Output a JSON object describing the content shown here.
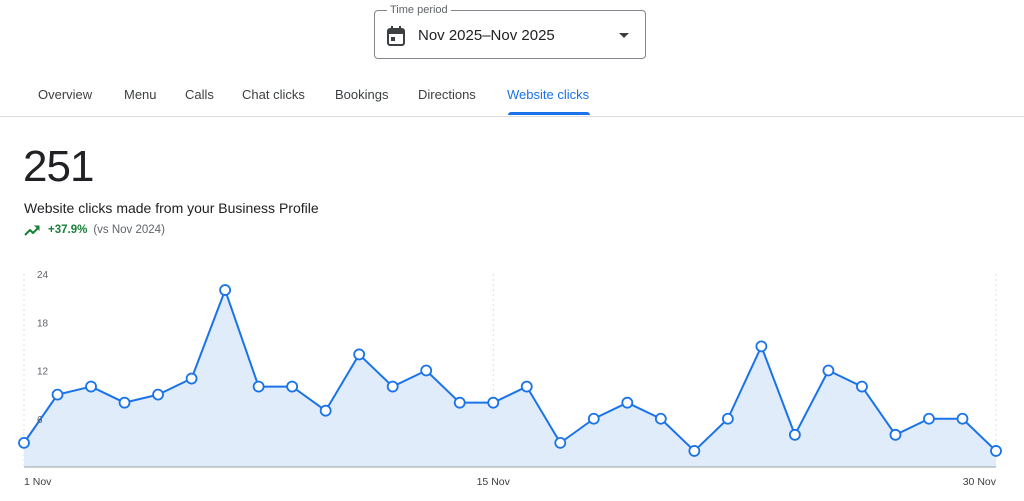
{
  "time_period": {
    "label": "Time period",
    "value": "Nov 2025–Nov 2025",
    "icon": "calendar-icon",
    "caret_icon": "arrow-drop-down-icon"
  },
  "tabs": [
    {
      "label": "Overview",
      "active": false
    },
    {
      "label": "Menu",
      "active": false
    },
    {
      "label": "Calls",
      "active": false
    },
    {
      "label": "Chat clicks",
      "active": false
    },
    {
      "label": "Bookings",
      "active": false
    },
    {
      "label": "Directions",
      "active": false
    },
    {
      "label": "Website clicks",
      "active": true
    }
  ],
  "metric": {
    "total": "251",
    "description": "Website clicks made from your Business Profile",
    "change": "+37.9%",
    "comparison": "(vs Nov 2024)",
    "trend_icon": "trending-up-icon"
  },
  "colors": {
    "accent": "#1a73e8",
    "area_fill": "#e1ecfb",
    "positive": "#188038"
  },
  "chart_data": {
    "type": "area",
    "x": [
      1,
      2,
      3,
      4,
      5,
      6,
      7,
      8,
      9,
      10,
      11,
      12,
      13,
      14,
      15,
      16,
      17,
      18,
      19,
      20,
      21,
      22,
      23,
      24,
      25,
      26,
      27,
      28,
      29,
      30
    ],
    "values": [
      3,
      9,
      10,
      8,
      9,
      11,
      22,
      10,
      10,
      7,
      14,
      10,
      12,
      8,
      8,
      10,
      3,
      6,
      8,
      6,
      2,
      6,
      15,
      4,
      12,
      10,
      4,
      6,
      6,
      2
    ],
    "x_tick_labels": [
      {
        "day": 1,
        "label": "1 Nov"
      },
      {
        "day": 15,
        "label": "15 Nov"
      },
      {
        "day": 30,
        "label": "30 Nov"
      }
    ],
    "y_ticks": [
      6,
      12,
      18,
      24
    ],
    "ylim": [
      0,
      24
    ],
    "xlim": [
      1,
      30
    ],
    "grid": "vertical dotted at labeled days",
    "legend": "none"
  }
}
